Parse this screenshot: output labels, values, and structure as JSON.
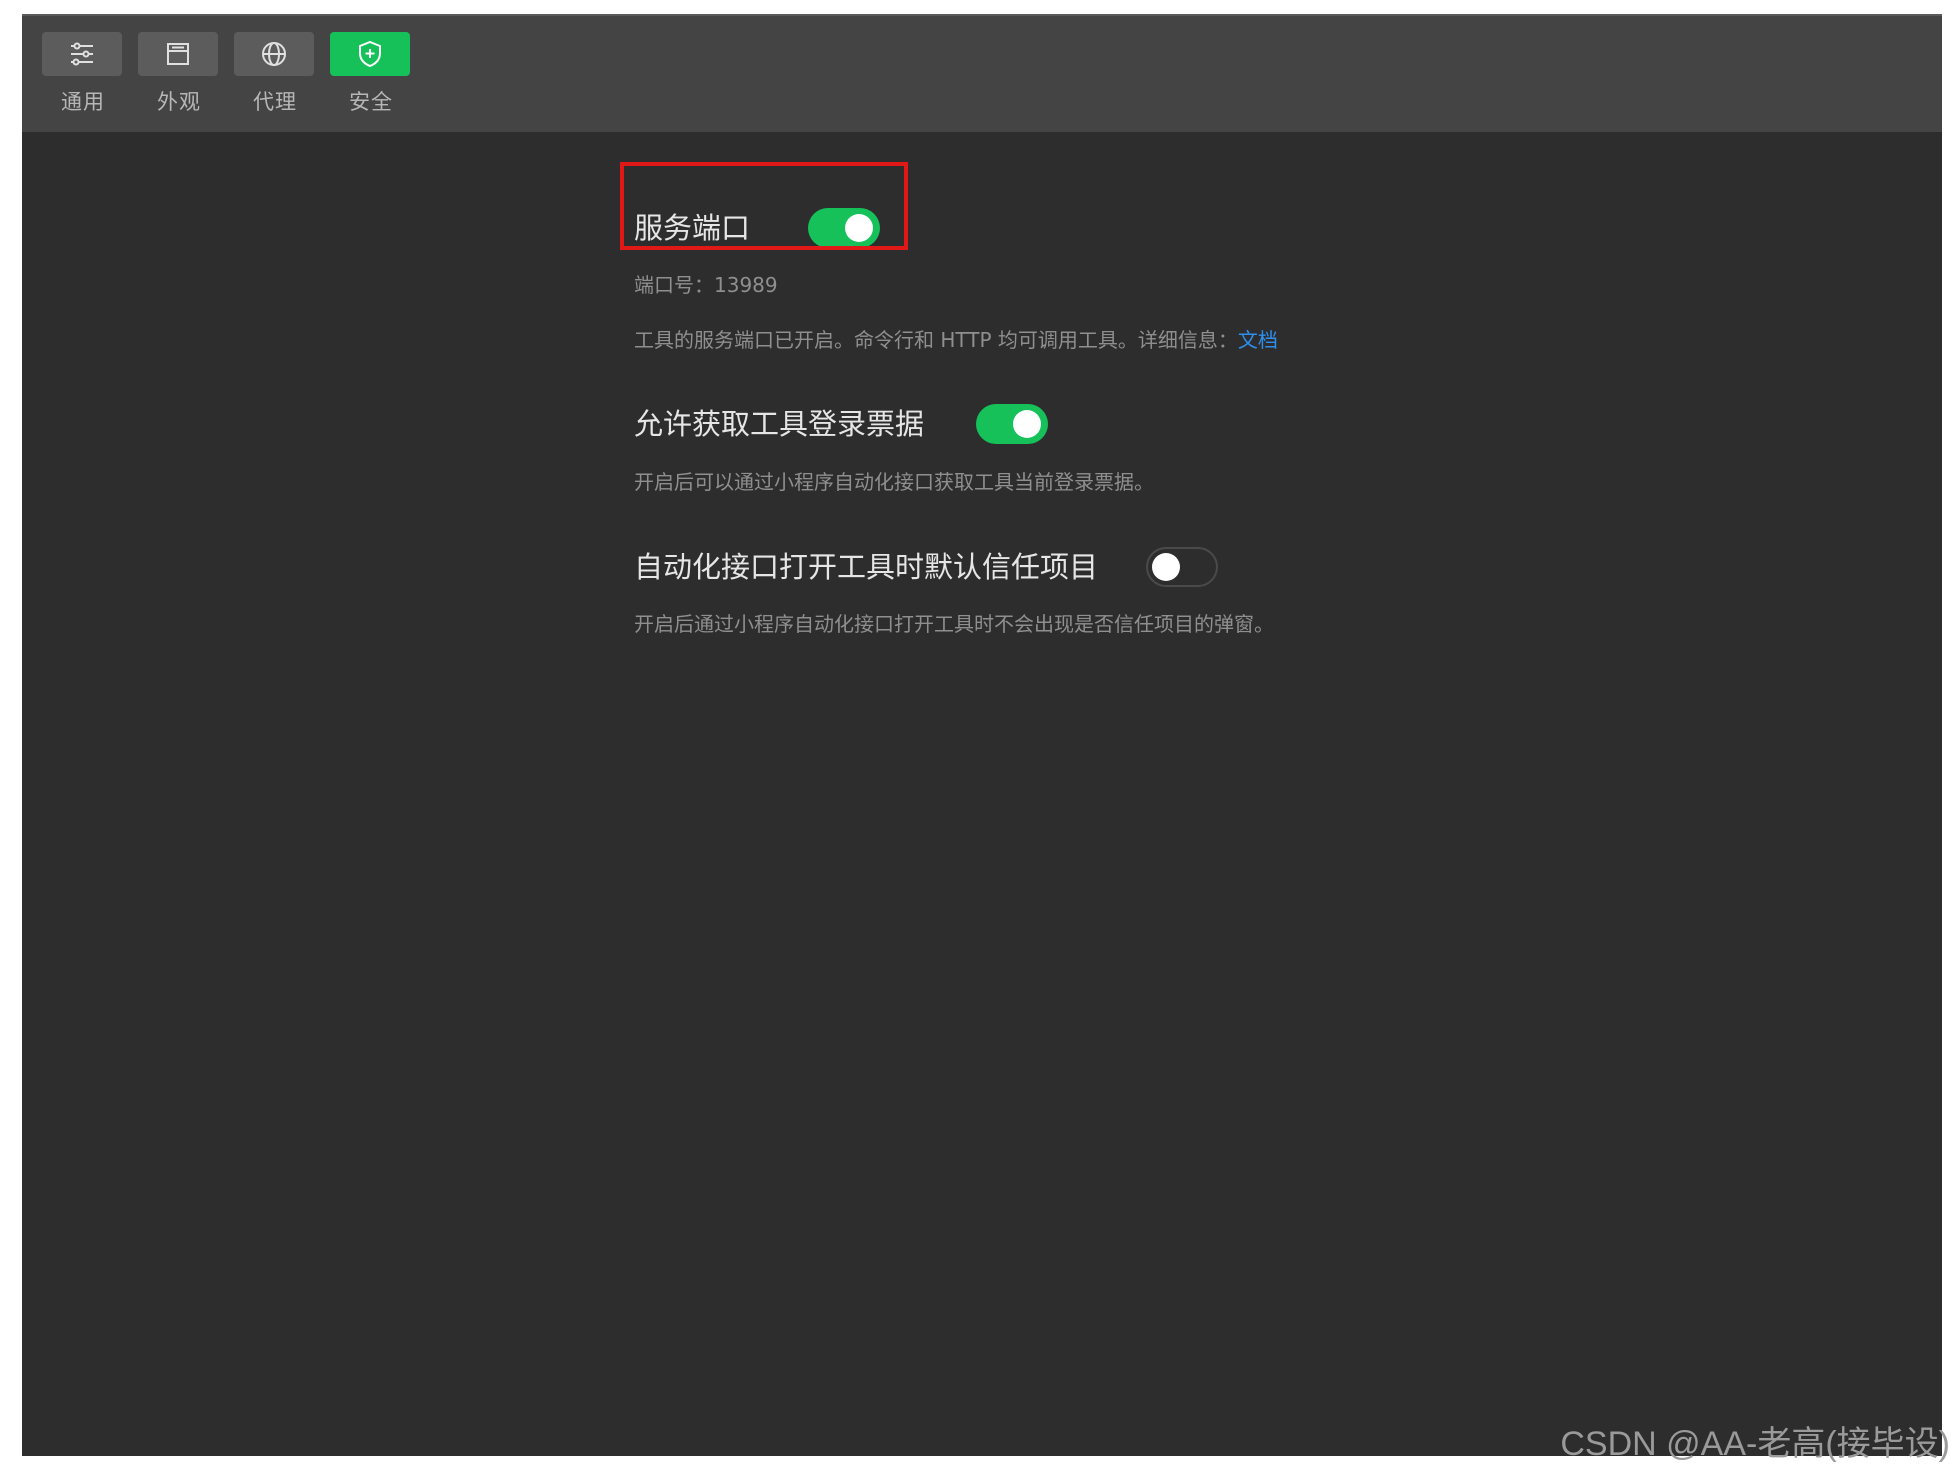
{
  "toolbar": {
    "tabs": [
      {
        "label": "通用",
        "icon": "sliders-icon",
        "active": false
      },
      {
        "label": "外观",
        "icon": "window-icon",
        "active": false
      },
      {
        "label": "代理",
        "icon": "globe-icon",
        "active": false
      },
      {
        "label": "安全",
        "icon": "shield-icon",
        "active": true
      }
    ]
  },
  "settings": {
    "service_port": {
      "title": "服务端口",
      "enabled": true,
      "port_line": "端口号：13989",
      "description": "工具的服务端口已开启。命令行和 HTTP 均可调用工具。详细信息：",
      "link_text": "文档"
    },
    "allow_login_ticket": {
      "title": "允许获取工具登录票据",
      "enabled": true,
      "description": "开启后可以通过小程序自动化接口获取工具当前登录票据。"
    },
    "auto_trust_project": {
      "title": "自动化接口打开工具时默认信任项目",
      "enabled": false,
      "description": "开启后通过小程序自动化接口打开工具时不会出现是否信任项目的弹窗。"
    }
  },
  "colors": {
    "accent": "#17c15a",
    "link": "#2d8ff0",
    "highlight": "#e01818"
  },
  "watermark": "CSDN @AA-老高(接毕设)"
}
